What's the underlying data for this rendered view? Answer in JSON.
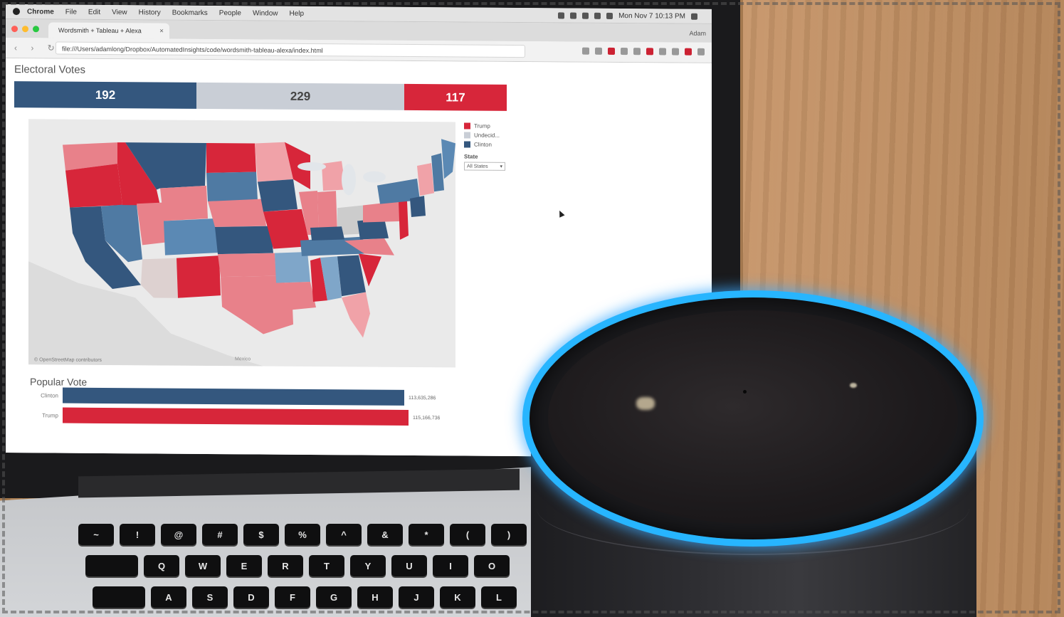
{
  "menubar": {
    "items": [
      "Chrome",
      "File",
      "Edit",
      "View",
      "History",
      "Bookmarks",
      "People",
      "Window",
      "Help"
    ],
    "clock": "Mon Nov 7 10:13 PM"
  },
  "browser": {
    "tab_title": "Wordsmith + Tableau + Alexa",
    "profile": "Adam",
    "url": "file:///Users/adamlong/Dropbox/AutomatedInsights/code/wordsmith-tableau-alexa/index.html"
  },
  "dashboard": {
    "electoral_title": "Electoral Votes",
    "electoral": {
      "clinton": "192",
      "undecided": "229",
      "trump": "117"
    },
    "legend": {
      "trump": "Trump",
      "undecided": "Undecid...",
      "clinton": "Clinton"
    },
    "state_filter": {
      "label": "State",
      "value": "All States"
    },
    "map_credit": "© OpenStreetMap contributors",
    "map_place": "Mexico",
    "popular_title": "Popular Vote",
    "popular": [
      {
        "label": "Clinton",
        "value": "113,635,286"
      },
      {
        "label": "Trump",
        "value": "115,166,736"
      }
    ]
  },
  "colors": {
    "clinton": "#34577e",
    "undecided": "#c9ced6",
    "trump": "#d7263a",
    "echo_ring": "#27b5ff"
  },
  "keyboard": {
    "row1": [
      "~",
      "!",
      "@",
      "#",
      "$",
      "%",
      "^",
      "&",
      "*",
      "(",
      ")"
    ],
    "row2": [
      "Q",
      "W",
      "E",
      "R",
      "T",
      "Y",
      "U",
      "I",
      "O"
    ],
    "row3": [
      "A",
      "S",
      "D",
      "F",
      "G",
      "H",
      "J",
      "K",
      "L"
    ]
  }
}
